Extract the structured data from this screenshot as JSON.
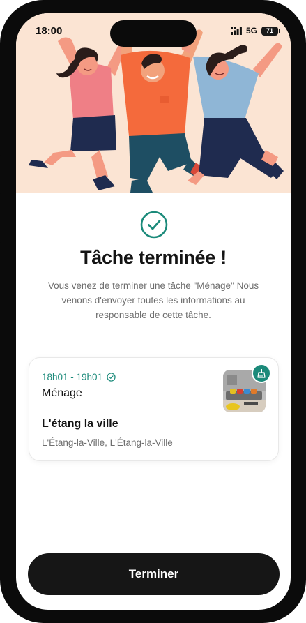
{
  "status_bar": {
    "time": "18:00",
    "network": "5G",
    "battery": "71"
  },
  "success": {
    "icon": "check-circle-icon",
    "title": "Tâche terminée !",
    "description": "Vous venez de terminer une tâche \"Ménage\" Nous venons d'envoyer toutes les informations au responsable de cette tâche."
  },
  "task": {
    "time_range": "18h01 - 19h01",
    "name": "Ménage",
    "place_name": "L'étang la ville",
    "place_address": "L'Étang-la-Ville, L'Étang-la-Ville",
    "badge_icon": "broom-icon"
  },
  "actions": {
    "finish_label": "Terminer"
  },
  "colors": {
    "accent": "#1b8a7a",
    "button": "#161616",
    "hero_bg": "#fbe4d3"
  }
}
